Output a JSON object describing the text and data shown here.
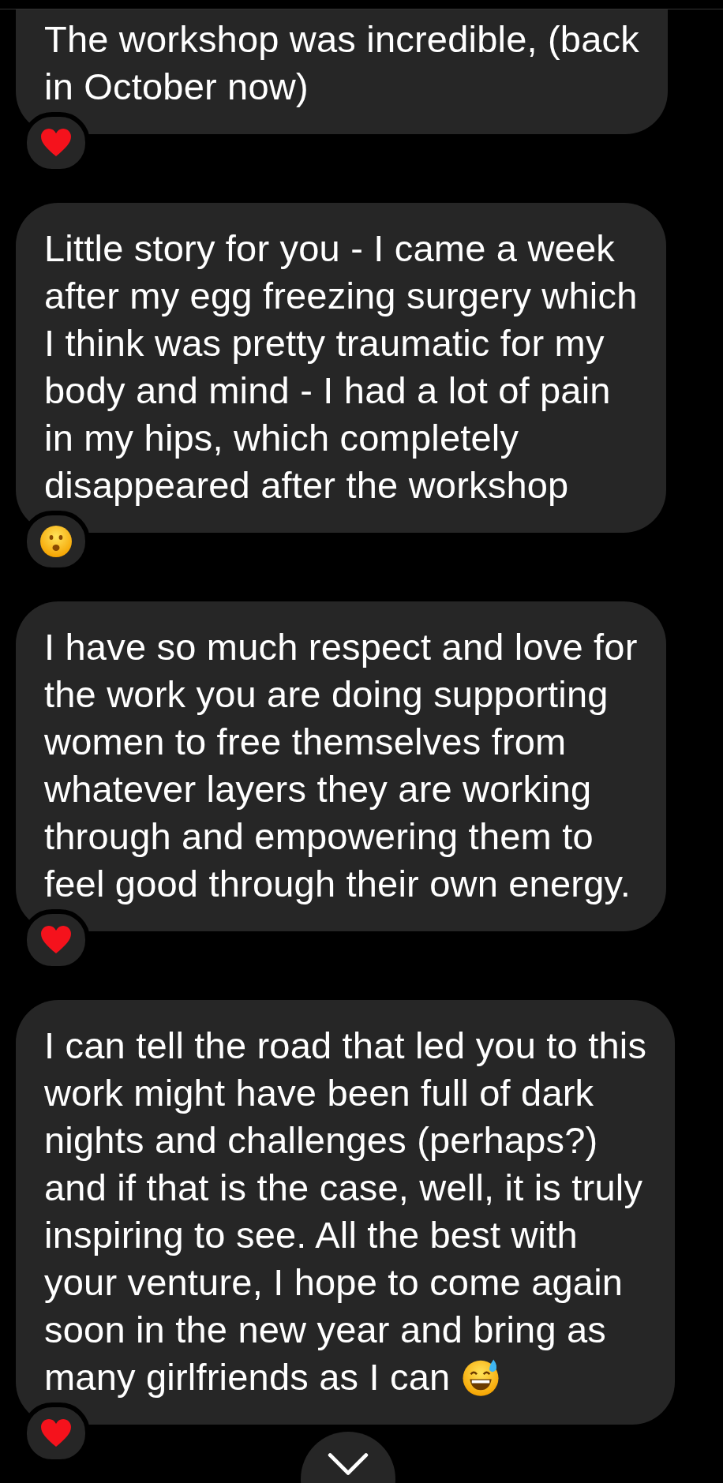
{
  "messages": [
    {
      "lines": [
        "The workshop was incredible, (back",
        "in October now)"
      ],
      "cut_top": true,
      "reaction": {
        "kind": "heart"
      }
    },
    {
      "lines": [
        "Little story for you - I came a week",
        "after my egg freezing surgery which",
        "I think was pretty traumatic for my",
        "body and mind - I had a lot of pain",
        "in my hips, which completely",
        "disappeared after the workshop"
      ],
      "reaction": {
        "kind": "surprised"
      }
    },
    {
      "lines": [
        "I have so much respect and love for",
        "the work you are doing supporting",
        "women to free themselves from",
        "whatever layers they are working",
        "through and empowering them to",
        "feel good through their own energy."
      ],
      "reaction": {
        "kind": "heart"
      }
    },
    {
      "lines": [
        "I can tell the road that led you to this",
        "work might have been full of dark",
        "nights and challenges (perhaps?)",
        "and if that is the case, well, it is truly",
        "inspiring to see. All the best with",
        "your venture, I hope to come again",
        "soon in the new year and bring as",
        "many girlfriends as I can"
      ],
      "end_icon": {
        "kind": "grin_sweat"
      },
      "reaction": {
        "kind": "heart"
      }
    }
  ],
  "scroll_down_button": {
    "kind": "chevron"
  }
}
